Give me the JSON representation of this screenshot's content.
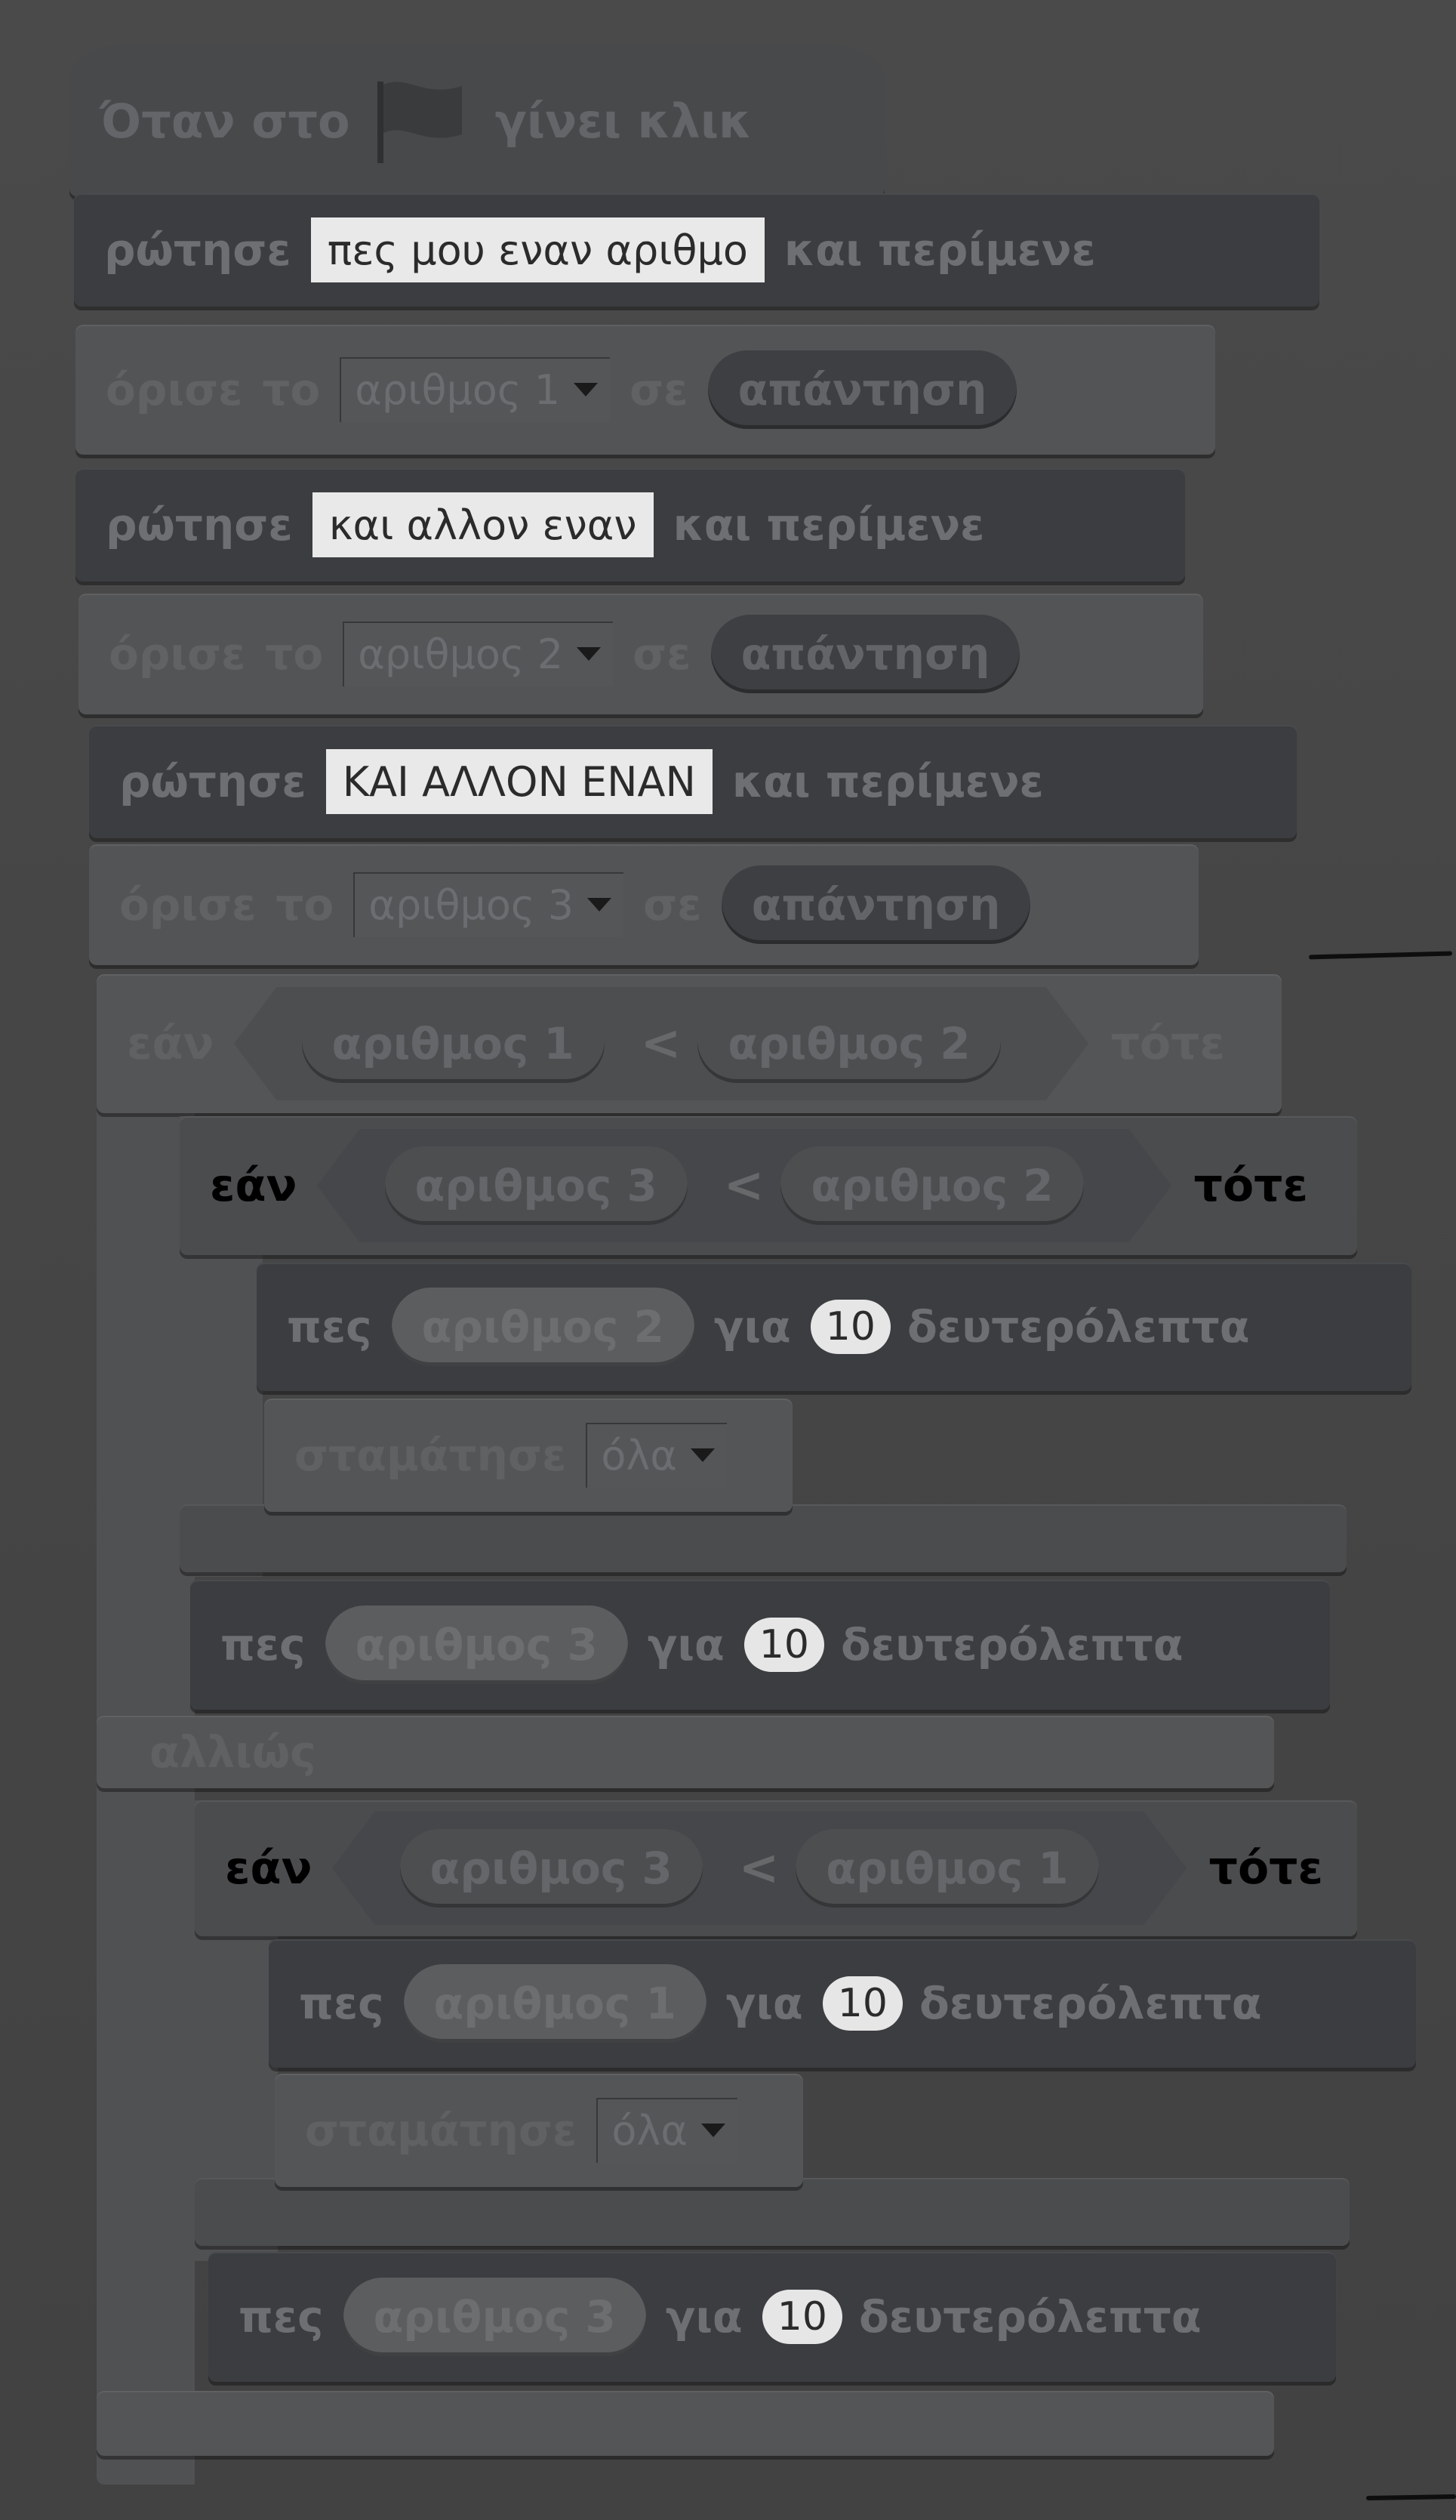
{
  "hat": {
    "pre": "Όταν στο",
    "post": "γίνει κλικ",
    "flag_icon": "green-flag-icon"
  },
  "blocks": {
    "ask1": {
      "kw": "ρώτησε",
      "text": "πες μου εναν αριθμο",
      "wait": "και περίμενε"
    },
    "set1": {
      "kw": "όρισε",
      "to": "το",
      "var": "αριθμος 1",
      "in": "σε",
      "rep": "απάντηση"
    },
    "ask2": {
      "kw": "ρώτησε",
      "text": "και αλλον εναν",
      "wait": "και περίμενε"
    },
    "set2": {
      "kw": "όρισε",
      "to": "το",
      "var": "αριθμος 2",
      "in": "σε",
      "rep": "απάντηση"
    },
    "ask3": {
      "kw": "ρώτησε",
      "text": "ΚΑΙ ΑΛΛΟΝ ΕΝΑΝ",
      "wait": "και περίμενε"
    },
    "set3": {
      "kw": "όρισε",
      "to": "το",
      "var": "αριθμος 3",
      "in": "σε",
      "rep": "απάντηση"
    }
  },
  "if1": {
    "kw": "εάν",
    "left": "αριθμος 1",
    "op": "<",
    "right": "αριθμος 2",
    "then": "τότε",
    "else": "αλλιώς"
  },
  "if2": {
    "kw": "εάν",
    "left": "αριθμος 3",
    "op": "<",
    "right": "αριθμος 2",
    "then": "τότε"
  },
  "say1": {
    "kw": "πες",
    "var": "αριθμος 2",
    "for": "για",
    "num": "10",
    "unit": "δευτερόλεπτα"
  },
  "stop1": {
    "kw": "σταμάτησε",
    "opt": "όλα"
  },
  "say2": {
    "kw": "πες",
    "var": "αριθμος 3",
    "for": "για",
    "num": "10",
    "unit": "δευτερόλεπτα"
  },
  "if3": {
    "kw": "εάν",
    "left": "αριθμος 3",
    "op": "<",
    "right": "αριθμος 1",
    "then": "τότε"
  },
  "say3": {
    "kw": "πες",
    "var": "αριθμος 1",
    "for": "για",
    "num": "10",
    "unit": "δευτερόλεπτα"
  },
  "stop2": {
    "kw": "σταμάτησε",
    "opt": "όλα"
  },
  "say4": {
    "kw": "πες",
    "var": "αριθμος 3",
    "for": "για",
    "num": "10",
    "unit": "δευτερόλεπτα"
  }
}
